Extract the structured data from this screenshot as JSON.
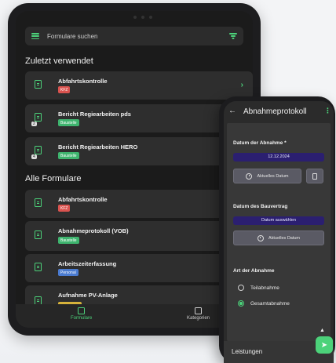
{
  "tablet": {
    "search_placeholder": "Formulare suchen",
    "recent_title": "Zuletzt verwendet",
    "recent": [
      {
        "title": "Abfahrtskontrolle",
        "tag": "KFZ"
      },
      {
        "title": "Bericht Regiearbeiten pds",
        "tag": "Baustelle",
        "count": "2"
      },
      {
        "title": "Bericht Regiearbeiten HERO",
        "tag": "Baustelle",
        "count": "4"
      }
    ],
    "all_title": "Alle Formulare",
    "all": [
      {
        "title": "Abfahrtskontrolle",
        "tag": "KFZ"
      },
      {
        "title": "Abnahmeprotokoll (VOB)",
        "tag": "Baustelle"
      },
      {
        "title": "Arbeitszeiterfassung",
        "tag": "Personal"
      },
      {
        "title": "Aufnahme PV-Anlage",
        "tag": ""
      }
    ],
    "nav": {
      "forms": "Formulare",
      "categories": "Kategorien"
    }
  },
  "phone": {
    "title": "Abnahmeprotokoll",
    "date_label": "Datum der Abnahme *",
    "date_value": "12.12.2024",
    "current_date_button": "Aktuelles Datum",
    "contract_label": "Datum des Bauvertrag",
    "choose_date": "Datum auswählen",
    "current_date_button2": "Aktuelles Datum",
    "type_label": "Art der Abnahme",
    "options": [
      "Teilabnahme",
      "Gesamtabnahme"
    ],
    "selected_option": "Gesamtabnahme",
    "footer": "Leistungen"
  },
  "colors": {
    "accent": "#4cd27a",
    "kfz": "#d9534f",
    "baustelle": "#3eb46e",
    "personal": "#4a7bd0",
    "date_pill": "#2b1f70"
  },
  "icons": [
    "menu-icon",
    "filter-icon",
    "document-icon",
    "chevron-right-icon",
    "folder-icon",
    "back-arrow-icon",
    "more-vertical-icon",
    "clock-icon",
    "trash-icon",
    "send-icon",
    "arrow-up-icon"
  ]
}
